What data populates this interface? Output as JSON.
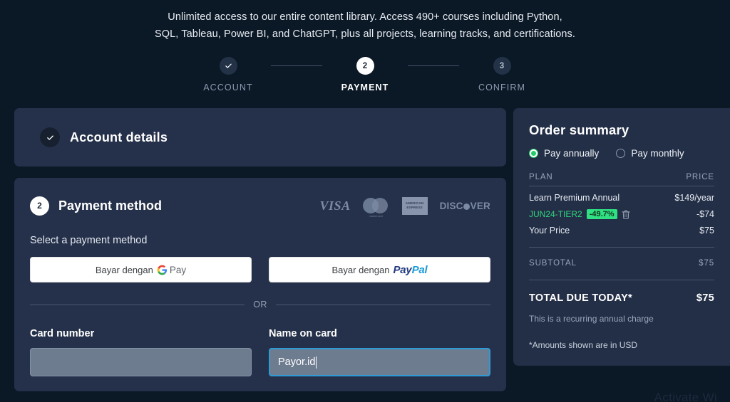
{
  "promo": {
    "line1": "Unlimited access to our entire content library. Access 490+ courses including Python,",
    "line2": "SQL, Tableau, Power BI, and ChatGPT, plus all projects, learning tracks, and certifications."
  },
  "stepper": {
    "steps": [
      {
        "label": "ACCOUNT",
        "bubble": "✓",
        "state": "done"
      },
      {
        "label": "PAYMENT",
        "bubble": "2",
        "state": "active"
      },
      {
        "label": "CONFIRM",
        "bubble": "3",
        "state": "todo"
      }
    ]
  },
  "account_section": {
    "title": "Account details",
    "check_icon": "check-icon"
  },
  "payment_section": {
    "step_number": "2",
    "title": "Payment method",
    "brands": [
      {
        "name": "visa-logo",
        "label": "VISA"
      },
      {
        "name": "mastercard-logo",
        "label": "mastercard"
      },
      {
        "name": "amex-logo",
        "label": "AMERICAN EXPRESS"
      },
      {
        "name": "discover-logo",
        "label": "DISC VER"
      }
    ],
    "select_label": "Select a payment method",
    "wallets": [
      {
        "name": "google-pay-button",
        "prefix": "Bayar dengan",
        "brand": "G Pay"
      },
      {
        "name": "paypal-button",
        "prefix": "Bayar dengan",
        "brand_a": "Pay",
        "brand_b": "Pal"
      }
    ],
    "or_text": "OR",
    "fields": [
      {
        "label": "Card number",
        "value": "",
        "placeholder": "",
        "focused": false
      },
      {
        "label": "Name on card",
        "value": "Payor.id",
        "placeholder": "",
        "focused": true
      }
    ]
  },
  "order_summary": {
    "title": "Order summary",
    "billing_options": [
      {
        "label": "Pay annually",
        "selected": true
      },
      {
        "label": "Pay monthly",
        "selected": false
      }
    ],
    "col_plan": "PLAN",
    "col_price": "PRICE",
    "plan_name": "Learn Premium Annual",
    "plan_price": "$149/year",
    "coupon_code": "JUN24-TIER2",
    "coupon_badge": "-49.7%",
    "coupon_amount": "-$74",
    "your_price_label": "Your Price",
    "your_price_value": "$75",
    "subtotal_label": "SUBTOTAL",
    "subtotal_value": "$75",
    "total_label": "TOTAL DUE TODAY*",
    "total_value": "$75",
    "recurring_note": "This is a recurring annual charge",
    "usd_note": "*Amounts shown are in USD",
    "accent_green": "#2fe183",
    "trash_icon": "trash-icon"
  },
  "watermark": {
    "text": "Activate Wi"
  }
}
